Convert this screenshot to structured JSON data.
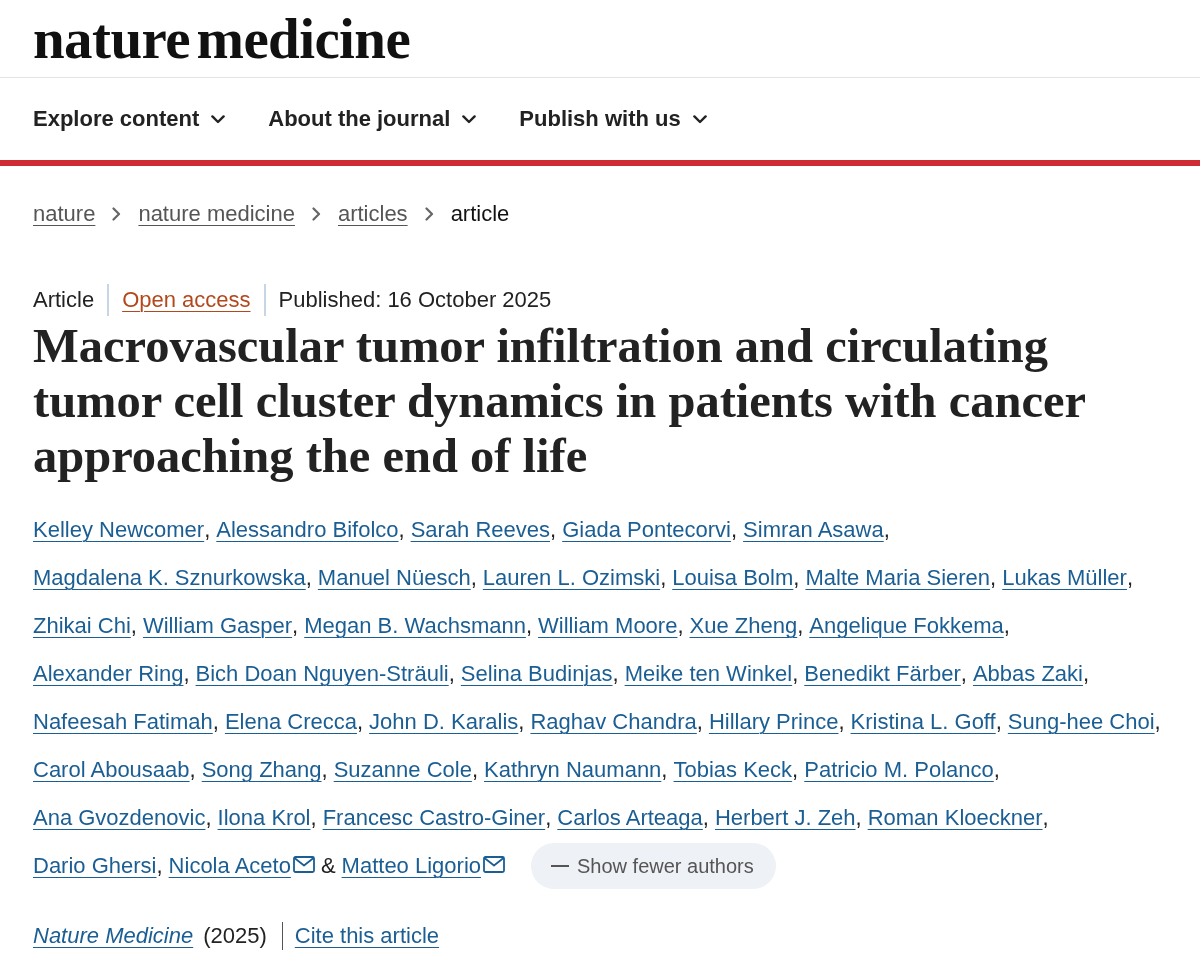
{
  "header": {
    "logo": "nature medicine"
  },
  "nav": [
    {
      "label": "Explore content",
      "expanded": false
    },
    {
      "label": "About the journal",
      "expanded": false
    },
    {
      "label": "Publish with us",
      "expanded": false
    }
  ],
  "breadcrumbs": [
    {
      "label": "nature",
      "current": false
    },
    {
      "label": "nature medicine",
      "current": false
    },
    {
      "label": "articles",
      "current": false
    },
    {
      "label": "article",
      "current": true
    }
  ],
  "article": {
    "meta": {
      "type": "Article",
      "access": "Open access",
      "published": "Published: 16 October 2025"
    },
    "title": "Macrovascular tumor infiltration and circulating tumor cell cluster dynamics in patients with cancer approaching the end of life",
    "authors": [
      {
        "name": "Kelley Newcomer",
        "corresponding": false,
        "separator": ","
      },
      {
        "name": "Alessandro Bifolco",
        "corresponding": false,
        "separator": ","
      },
      {
        "name": "Sarah Reeves",
        "corresponding": false,
        "separator": ","
      },
      {
        "name": "Giada Pontecorvi",
        "corresponding": false,
        "separator": ","
      },
      {
        "name": "Simran Asawa",
        "corresponding": false,
        "separator": ","
      },
      {
        "name": "Magdalena K. Sznurkowska",
        "corresponding": false,
        "separator": ","
      },
      {
        "name": "Manuel Nüesch",
        "corresponding": false,
        "separator": ","
      },
      {
        "name": "Lauren L. Ozimski",
        "corresponding": false,
        "separator": ","
      },
      {
        "name": "Louisa Bolm",
        "corresponding": false,
        "separator": ","
      },
      {
        "name": "Malte Maria Sieren",
        "corresponding": false,
        "separator": ","
      },
      {
        "name": "Lukas Müller",
        "corresponding": false,
        "separator": ","
      },
      {
        "name": "Zhikai Chi",
        "corresponding": false,
        "separator": ","
      },
      {
        "name": "William Gasper",
        "corresponding": false,
        "separator": ","
      },
      {
        "name": "Megan B. Wachsmann",
        "corresponding": false,
        "separator": ","
      },
      {
        "name": "William Moore",
        "corresponding": false,
        "separator": ","
      },
      {
        "name": "Xue Zheng",
        "corresponding": false,
        "separator": ","
      },
      {
        "name": "Angelique Fokkema",
        "corresponding": false,
        "separator": ","
      },
      {
        "name": "Alexander Ring",
        "corresponding": false,
        "separator": ","
      },
      {
        "name": "Bich Doan Nguyen-Sträuli",
        "corresponding": false,
        "separator": ","
      },
      {
        "name": "Selina Budinjas",
        "corresponding": false,
        "separator": ","
      },
      {
        "name": "Meike ten Winkel",
        "corresponding": false,
        "separator": ","
      },
      {
        "name": "Benedikt Färber",
        "corresponding": false,
        "separator": ","
      },
      {
        "name": "Abbas Zaki",
        "corresponding": false,
        "separator": ","
      },
      {
        "name": "Nafeesah Fatimah",
        "corresponding": false,
        "separator": ","
      },
      {
        "name": "Elena Crecca",
        "corresponding": false,
        "separator": ","
      },
      {
        "name": "John D. Karalis",
        "corresponding": false,
        "separator": ","
      },
      {
        "name": "Raghav Chandra",
        "corresponding": false,
        "separator": ","
      },
      {
        "name": "Hillary Prince",
        "corresponding": false,
        "separator": ","
      },
      {
        "name": "Kristina L. Goff",
        "corresponding": false,
        "separator": ","
      },
      {
        "name": "Sung-hee Choi",
        "corresponding": false,
        "separator": ","
      },
      {
        "name": "Carol Abousaab",
        "corresponding": false,
        "separator": ","
      },
      {
        "name": "Song Zhang",
        "corresponding": false,
        "separator": ","
      },
      {
        "name": "Suzanne Cole",
        "corresponding": false,
        "separator": ","
      },
      {
        "name": "Kathryn Naumann",
        "corresponding": false,
        "separator": ","
      },
      {
        "name": "Tobias Keck",
        "corresponding": false,
        "separator": ","
      },
      {
        "name": "Patricio M. Polanco",
        "corresponding": false,
        "separator": ","
      },
      {
        "name": "Ana Gvozdenovic",
        "corresponding": false,
        "separator": ","
      },
      {
        "name": "Ilona Krol",
        "corresponding": false,
        "separator": ","
      },
      {
        "name": "Francesc Castro-Giner",
        "corresponding": false,
        "separator": ","
      },
      {
        "name": "Carlos Arteaga",
        "corresponding": false,
        "separator": ","
      },
      {
        "name": "Herbert J. Zeh",
        "corresponding": false,
        "separator": ","
      },
      {
        "name": "Roman Kloeckner",
        "corresponding": false,
        "separator": ","
      },
      {
        "name": "Dario Ghersi",
        "corresponding": false,
        "separator": ","
      },
      {
        "name": "Nicola Aceto",
        "corresponding": true,
        "separator": "&"
      },
      {
        "name": "Matteo Ligorio",
        "corresponding": true
      }
    ],
    "toggle_authors": "Show fewer authors",
    "citation": {
      "journal": "Nature Medicine",
      "year": "(2025)",
      "cite_link": "Cite this article"
    }
  }
}
